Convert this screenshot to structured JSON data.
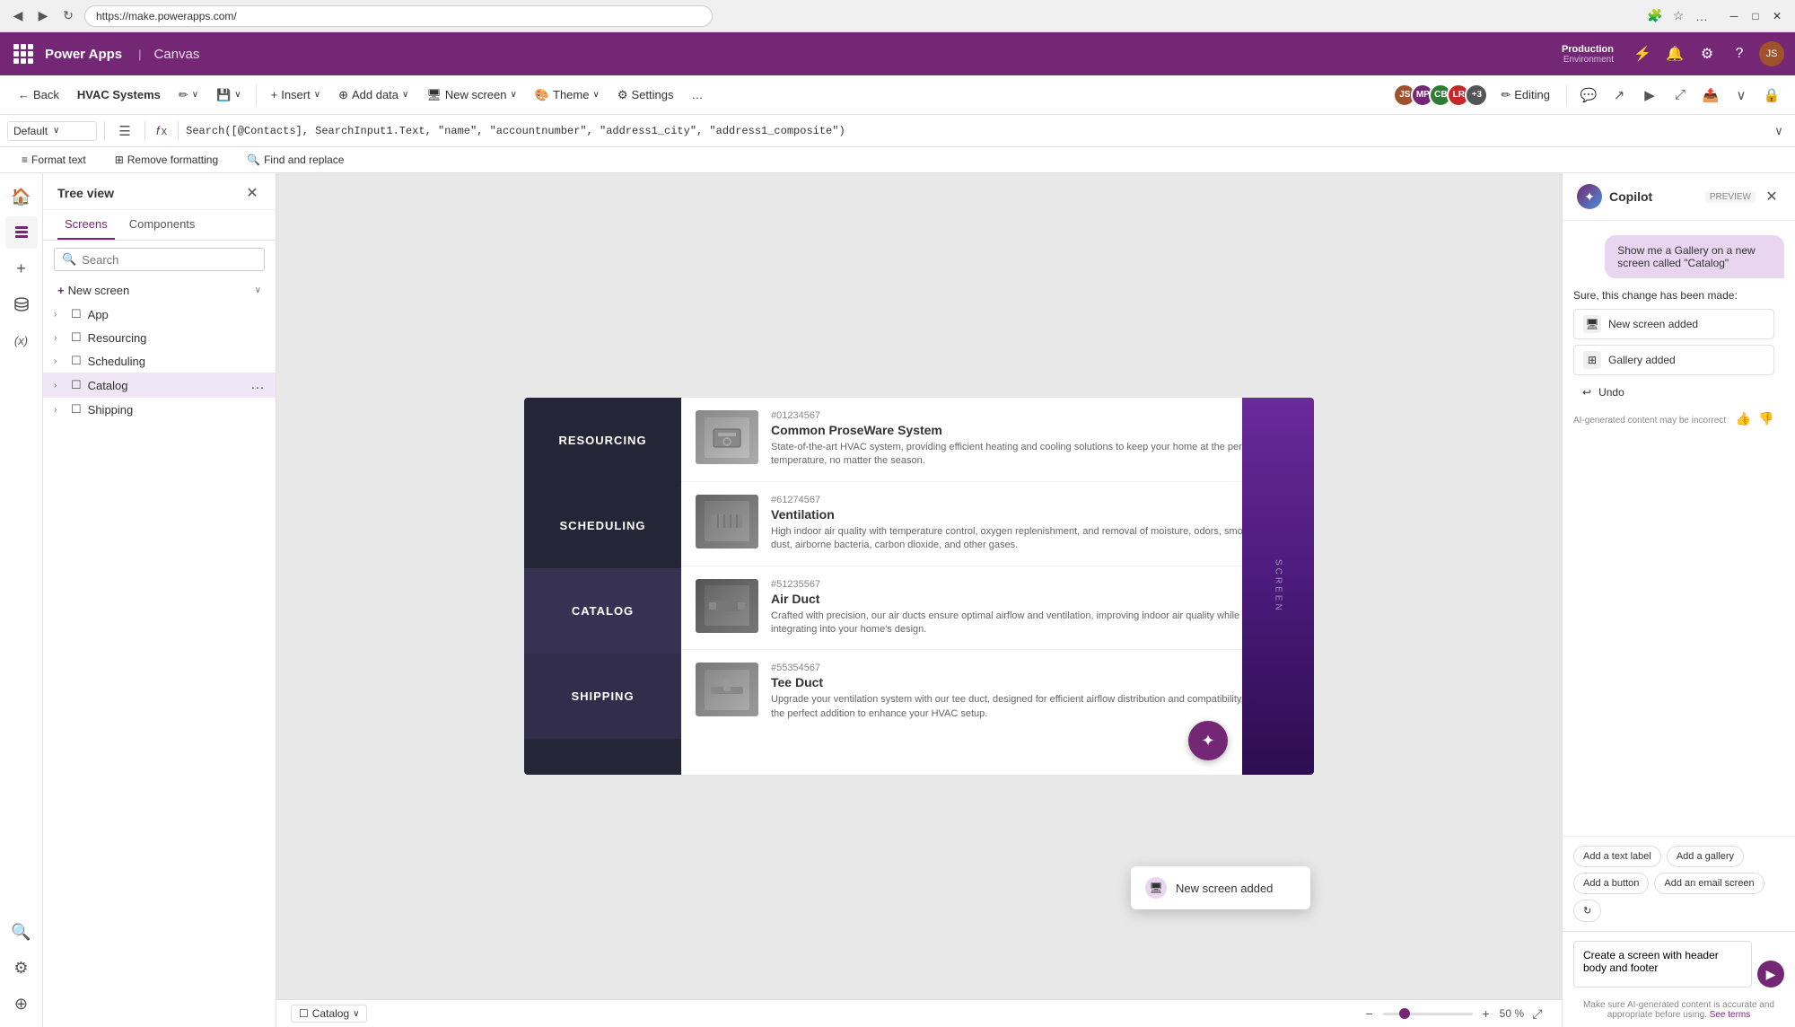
{
  "browser": {
    "url": "https://make.powerapps.com/",
    "back_btn": "◀",
    "forward_btn": "▶",
    "refresh_btn": "↻"
  },
  "app_header": {
    "brand": "Power Apps",
    "canvas": "Canvas",
    "env_label": "Environment",
    "env_name": "Production",
    "app_name": "HVAC Systems"
  },
  "toolbar": {
    "back_label": "Back",
    "insert_label": "Insert",
    "add_data_label": "Add data",
    "new_screen_label": "New screen",
    "theme_label": "Theme",
    "settings_label": "Settings",
    "editing_label": "Editing"
  },
  "formula_bar": {
    "dropdown_value": "Default",
    "fx_symbol": "fx",
    "formula": "Search([@Contacts], SearchInput1.Text, \"name\", \"accountnumber\", \"address1_city\", \"address1_composite\")"
  },
  "tree_view": {
    "title": "Tree view",
    "tabs": [
      "Screens",
      "Components"
    ],
    "active_tab": "Screens",
    "search_placeholder": "Search",
    "new_screen_label": "New screen",
    "items": [
      {
        "label": "App",
        "type": "app",
        "expanded": false
      },
      {
        "label": "Resourcing",
        "type": "screen",
        "expanded": false
      },
      {
        "label": "Scheduling",
        "type": "screen",
        "expanded": false
      },
      {
        "label": "Catalog",
        "type": "screen",
        "expanded": true,
        "selected": true
      },
      {
        "label": "Shipping",
        "type": "screen",
        "expanded": false
      }
    ]
  },
  "canvas_toolbar": {
    "format_text": "Format text",
    "remove_formatting": "Remove formatting",
    "find_replace": "Find and replace"
  },
  "canvas": {
    "nav_items": [
      {
        "label": "RESOURCING"
      },
      {
        "label": "SCHEDULING"
      },
      {
        "label": "CATALOG",
        "active": true
      },
      {
        "label": "SHIPPING"
      }
    ],
    "products": [
      {
        "id": "#01234567",
        "name": "Common ProseWare System",
        "desc": "State-of-the-art HVAC system, providing efficient heating and cooling solutions to keep your home at the perfect temperature, no matter the season."
      },
      {
        "id": "#61274567",
        "name": "Ventilation",
        "desc": "High indoor air quality with temperature control, oxygen replenishment, and removal of moisture, odors, smoke, heat, dust, airborne bacteria, carbon dioxide, and other gases."
      },
      {
        "id": "#51235567",
        "name": "Air Duct",
        "desc": "Crafted with precision, our air ducts ensure optimal airflow and ventilation, improving indoor air quality while seamlessly integrating into your home's design."
      },
      {
        "id": "#55354567",
        "name": "Tee Duct",
        "desc": "Upgrade your ventilation system with our tee duct, designed for efficient airflow distribution and compatibility, making it the perfect addition to enhance your HVAC setup."
      }
    ],
    "screen_label": "SCREEN",
    "current_screen": "Catalog",
    "zoom_percent": "50 %"
  },
  "copilot": {
    "title": "Copilot",
    "preview_label": "PREVIEW",
    "user_message": "Show me a Gallery on a new screen called \"Catalog\"",
    "system_response": "Sure, this change has been made:",
    "changes": [
      {
        "label": "New screen added",
        "icon": "🖥"
      },
      {
        "label": "Gallery added",
        "icon": "🖼"
      }
    ],
    "undo_label": "Undo",
    "ai_disclaimer": "AI-generated content may be incorrect",
    "suggestions": [
      {
        "label": "Add a text label"
      },
      {
        "label": "Add a gallery"
      },
      {
        "label": "Add a button"
      },
      {
        "label": "Add an email screen"
      }
    ],
    "input_placeholder": "Create a screen with header body and footer",
    "input_value": "Create a screen with header body and footer",
    "disclaimer_text": "Make sure AI-generated content is accurate and appropriate before using.",
    "see_terms": "See terms"
  },
  "notification": {
    "text": "New screen added"
  },
  "avatars": [
    {
      "initials": "JS",
      "color": "#a0522d"
    },
    {
      "initials": "MP",
      "color": "#742774"
    },
    {
      "initials": "CB",
      "color": "#2e7d32"
    },
    {
      "initials": "LR",
      "color": "#c62828"
    },
    {
      "extra": "+3"
    }
  ],
  "icons": {
    "waffle": "⊞",
    "back_arrow": "←",
    "pencil": "✏",
    "insert": "+",
    "add_data": "⊕",
    "new_screen": "🖥",
    "theme": "🎨",
    "settings": "⚙",
    "more": "…",
    "play": "▶",
    "chevron_down": "∨",
    "search": "🔍",
    "close": "✕",
    "plus": "+",
    "undo": "↩",
    "thumbup": "👍",
    "thumbdown": "👎",
    "send": "▶",
    "refresh": "↻",
    "zoom_in": "+",
    "zoom_out": "−",
    "fullscreen": "⤢"
  }
}
